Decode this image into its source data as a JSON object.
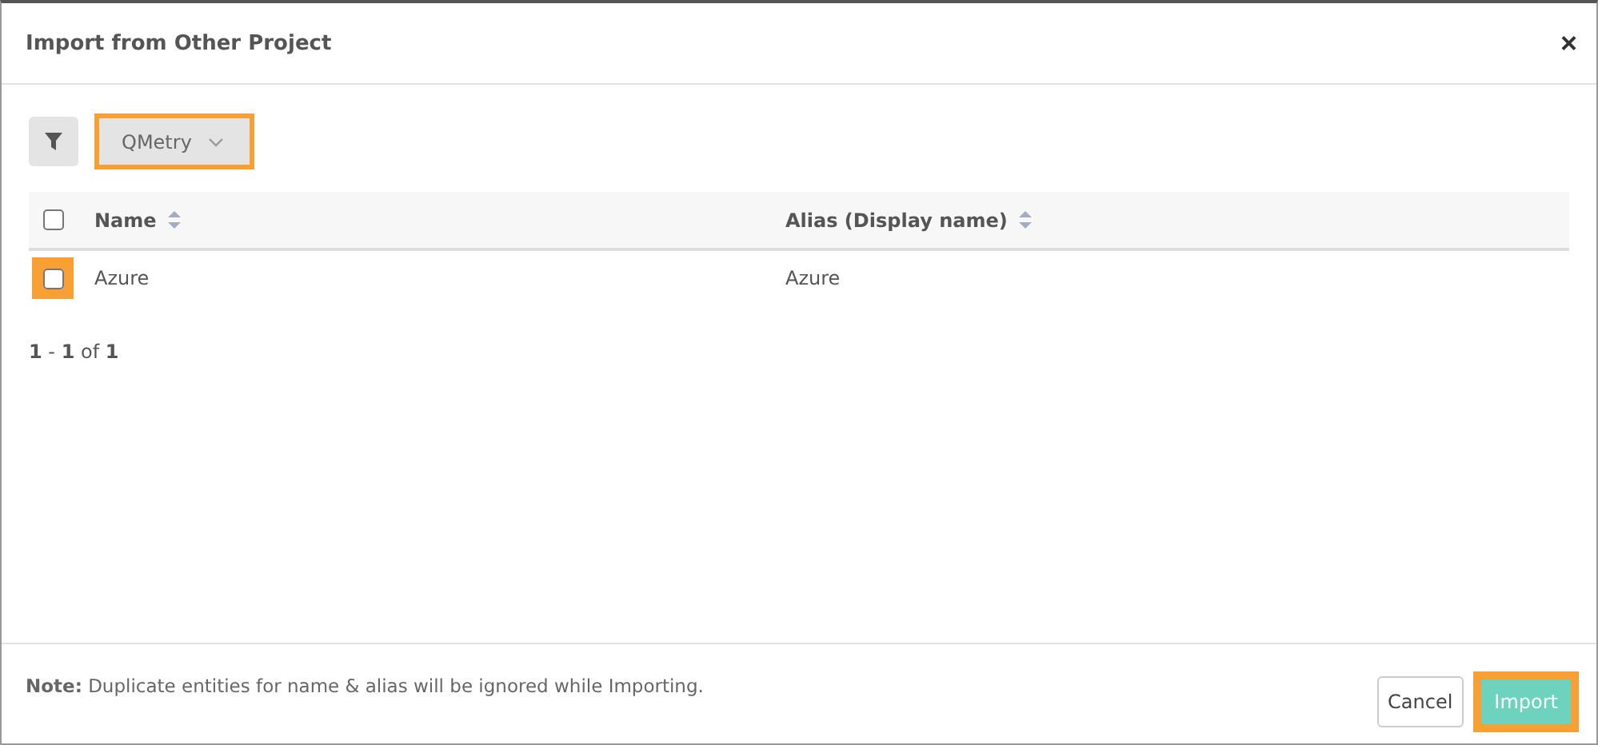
{
  "dialog": {
    "title": "Import from Other Project",
    "close": "×"
  },
  "toolbar": {
    "project": {
      "value": "QMetry",
      "highlighted": true
    }
  },
  "table": {
    "header_checkbox": {
      "checked": false
    },
    "columns": [
      "Name",
      "Alias (Display name)"
    ],
    "rows": [
      {
        "checked": false,
        "highlighted": true,
        "cells": [
          "Azure",
          "Azure"
        ]
      }
    ]
  },
  "pagination": "**1** - **1** of **1**",
  "footer": {
    "note": "**Note:** Duplicate entities for name & alias will be ignored while Importing.",
    "buttons": [
      {
        "label": "Cancel",
        "kind": "secondary",
        "highlighted": false
      },
      {
        "label": "Import",
        "kind": "primary",
        "highlighted": true
      }
    ]
  }
}
